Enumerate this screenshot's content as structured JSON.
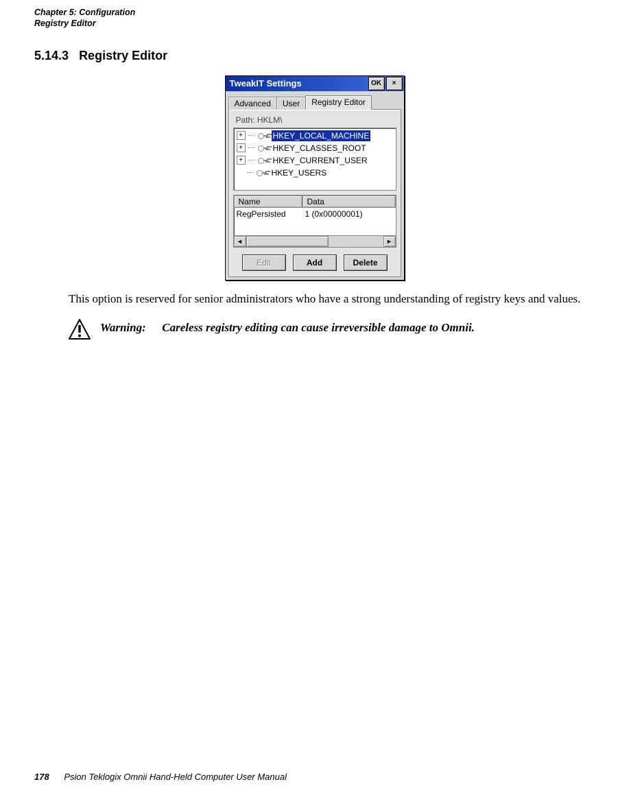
{
  "header": {
    "chapter_line": "Chapter 5:  Configuration",
    "subtitle": "Registry Editor"
  },
  "section": {
    "number": "5.14.3",
    "title": "Registry Editor"
  },
  "window": {
    "title": "TweakIT Settings",
    "ok": "OK",
    "close": "×",
    "tabs": {
      "advanced": "Advanced",
      "user": "User",
      "registry": "Registry Editor"
    },
    "path_label": "Path: HKLM\\",
    "tree": {
      "items": [
        {
          "label": "HKEY_LOCAL_MACHINE",
          "selected": true,
          "expandable": true
        },
        {
          "label": "HKEY_CLASSES_ROOT",
          "selected": false,
          "expandable": true
        },
        {
          "label": "HKEY_CURRENT_USER",
          "selected": false,
          "expandable": true
        },
        {
          "label": "HKEY_USERS",
          "selected": false,
          "expandable": false
        }
      ]
    },
    "list": {
      "col_name": "Name",
      "col_data": "Data",
      "row_name": "RegPersisted",
      "row_data": "1 (0x00000001)"
    },
    "scroll": {
      "left": "◄",
      "right": "►"
    },
    "buttons": {
      "edit": "Edit",
      "add": "Add",
      "delete": "Delete"
    }
  },
  "body_paragraph": "This option is reserved for senior administrators who have a strong understanding of registry keys and values.",
  "warning": {
    "label": "Warning:",
    "text": "Careless registry editing can cause irreversible damage to Omnii."
  },
  "footer": {
    "page_number": "178",
    "manual": "Psion Teklogix Omnii Hand-Held Computer User Manual"
  }
}
